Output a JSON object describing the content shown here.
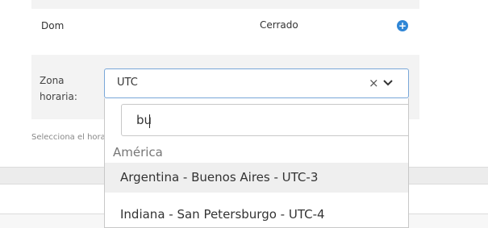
{
  "schedule": {
    "day_label": "Dom",
    "day_status": "Cerrado",
    "add_icon": "plus-circle-icon",
    "timezone_label_line1": "Zona",
    "timezone_label_line2": "horaria:",
    "hint": "Selecciona el horario"
  },
  "timezone_select": {
    "selected_value": "UTC",
    "clear_icon": "×",
    "caret_icon": "chevron-down-icon"
  },
  "dropdown": {
    "search_value": "bu",
    "group_label": "América",
    "options": [
      {
        "label": "Argentina - Buenos Aires - UTC-3",
        "highlighted": true
      },
      {
        "label": "Indiana - San Petersburgo - UTC-4",
        "highlighted": false
      }
    ]
  },
  "colors": {
    "accent": "#2f86d6",
    "highlight": "#efefef",
    "panel_gray": "#f3f3f3"
  }
}
